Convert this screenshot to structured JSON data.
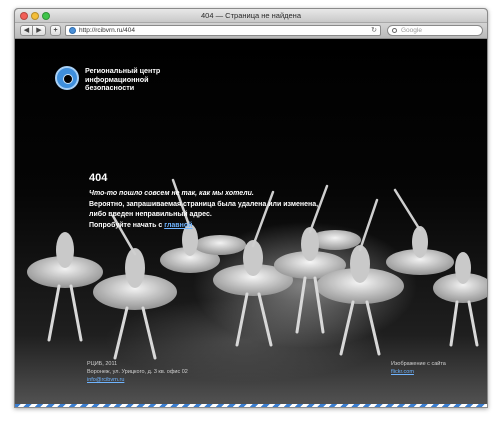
{
  "window": {
    "title": "404 — Страница не найдена"
  },
  "toolbar": {
    "back_glyph": "◀",
    "forward_glyph": "▶",
    "add_glyph": "+",
    "url": "http://rcibvrn.ru/404",
    "reload_glyph": "↻",
    "search_placeholder": "Google"
  },
  "header": {
    "org_name_line1": "Региональный центр",
    "org_name_line2": "информационной",
    "org_name_line3": "безопасности"
  },
  "error": {
    "code": "404",
    "line1": "Что-то пошло совсем не так, как мы хотели.",
    "line2": "Вероятно, запрашиваемая страница была удалена или изменена,",
    "line3": "либо введен неправильный адрес.",
    "line4_prefix": "Попробуйте начать с ",
    "home_link": "главной"
  },
  "footer": {
    "copyright": "РЦИБ, 2011",
    "address": "Воронеж, ул. Урицкого, д. 3 кв. офис 02",
    "left_link": "info@rcibvrn.ru",
    "image_credit": "Изображение с сайта",
    "image_link": "flickr.com"
  },
  "colors": {
    "accent": "#3f8fdc",
    "link": "#6fb4ff",
    "stripe": "#3c7fd1"
  },
  "icons": {
    "close": "close-button-icon",
    "minimize": "minimize-button-icon",
    "zoom": "zoom-button-icon",
    "globe": "globe-icon",
    "reload": "reload-icon",
    "search": "search-icon",
    "logo": "rcib-logo-icon"
  }
}
